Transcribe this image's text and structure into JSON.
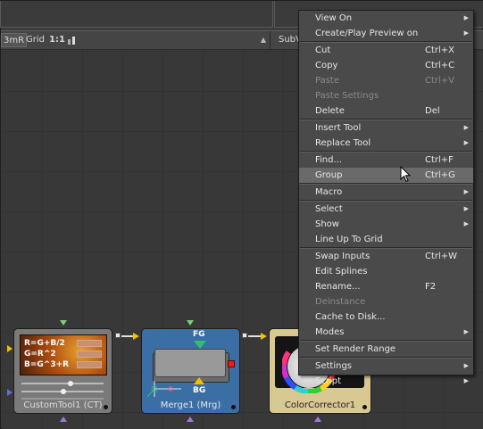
{
  "toolbar": {
    "left_fragment": "3mR",
    "grid_label": "Grid",
    "ratio_label": "1:1",
    "sub_label": "SubV"
  },
  "nodes": {
    "custom_tool": {
      "label": "CustomTool1  (CT)",
      "expr1": "R=G+B/2",
      "expr2": "G=R^2",
      "expr3": "B=G^3+R"
    },
    "merge": {
      "label": "Merge1  (Mrg)",
      "fg": "FG",
      "bg": "BG"
    },
    "color_corrector": {
      "label": "ColorCorrector1"
    }
  },
  "context_menu": {
    "groups": [
      [
        {
          "label": "View On",
          "submenu": true
        },
        {
          "label": "Create/Play Preview on",
          "submenu": true
        }
      ],
      [
        {
          "label": "Cut",
          "shortcut": "Ctrl+X"
        },
        {
          "label": "Copy",
          "shortcut": "Ctrl+C"
        },
        {
          "label": "Paste",
          "shortcut": "Ctrl+V",
          "disabled": true
        },
        {
          "label": "Paste Settings",
          "disabled": true
        },
        {
          "label": "Delete",
          "shortcut": "Del"
        }
      ],
      [
        {
          "label": "Insert Tool",
          "submenu": true
        },
        {
          "label": "Replace Tool",
          "submenu": true
        }
      ],
      [
        {
          "label": "Find...",
          "shortcut": "Ctrl+F"
        },
        {
          "label": "Group",
          "shortcut": "Ctrl+G",
          "highlighted": true
        }
      ],
      [
        {
          "label": "Macro",
          "submenu": true
        }
      ],
      [
        {
          "label": "Select",
          "submenu": true
        },
        {
          "label": "Show",
          "submenu": true
        },
        {
          "label": "Line Up To Grid"
        }
      ],
      [
        {
          "label": "Swap Inputs",
          "shortcut": "Ctrl+W"
        },
        {
          "label": "Edit Splines"
        },
        {
          "label": "Rename...",
          "shortcut": "F2"
        },
        {
          "label": "Deinstance",
          "disabled": true
        },
        {
          "label": "Cache to Disk..."
        },
        {
          "label": "Modes",
          "submenu": true
        }
      ],
      [
        {
          "label": "Set Render Range"
        }
      ],
      [
        {
          "label": "Settings",
          "submenu": true
        },
        {
          "label": "Script",
          "submenu": true
        }
      ]
    ]
  },
  "colors": {
    "merge_node": "#3a6ea5",
    "custom_node": "#7a7a7a",
    "cc_node": "#d8c892",
    "menu_bg": "#4a4a4a",
    "menu_highlight": "#6a6a6a"
  }
}
